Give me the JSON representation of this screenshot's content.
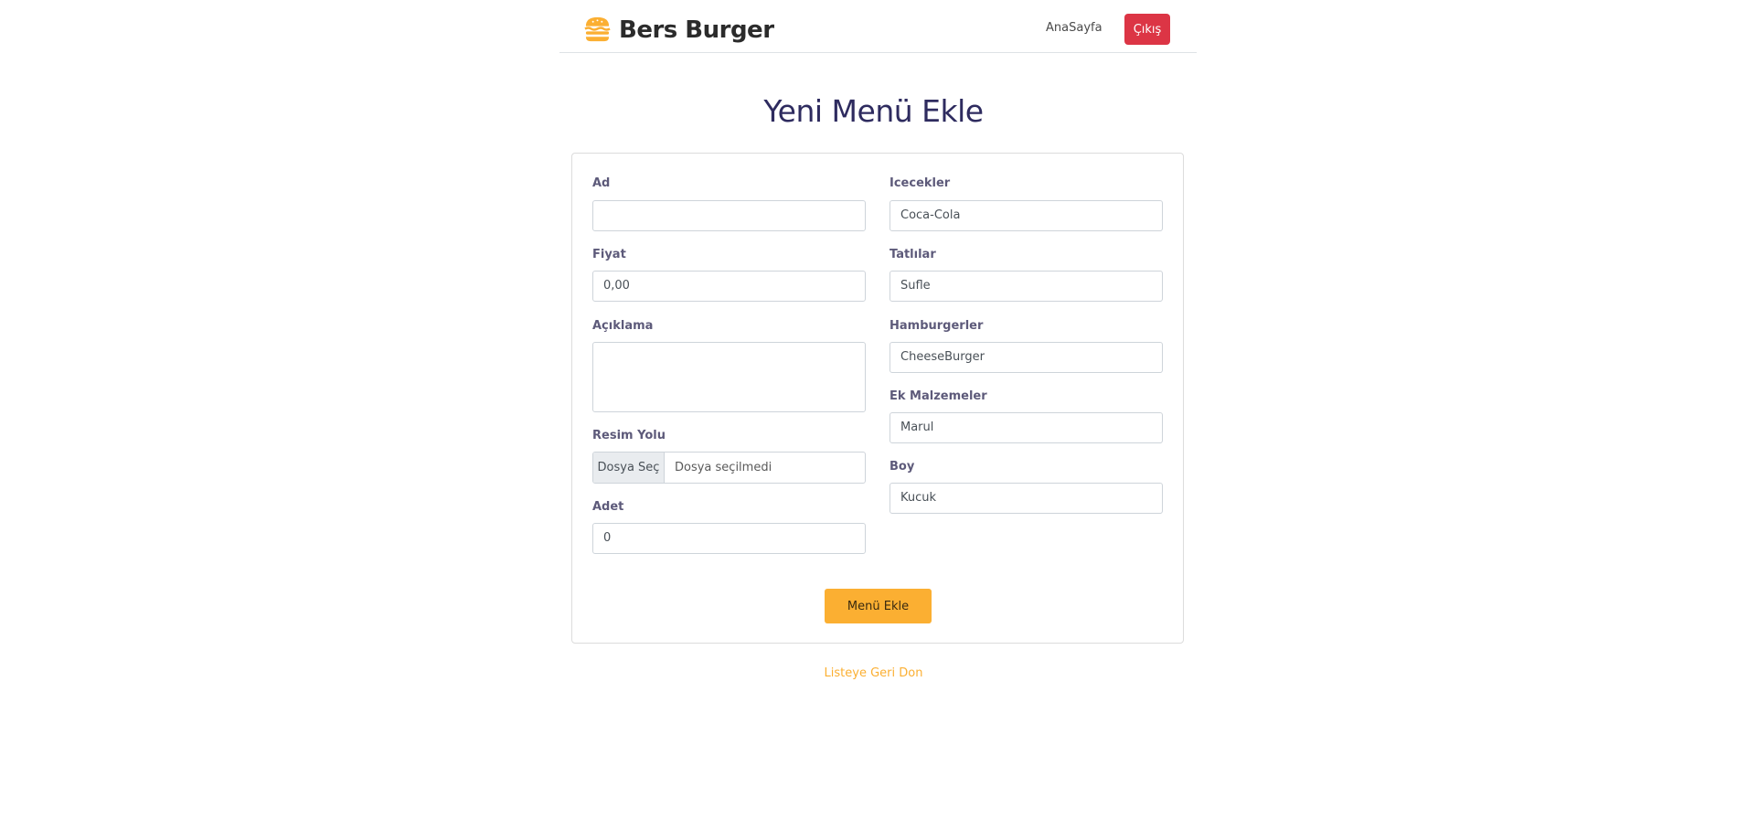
{
  "header": {
    "brand_name": "Bers Burger",
    "brand_icon": "burger-icon",
    "nav_home_label": "AnaSayfa",
    "logout_label": "Çıkış"
  },
  "page": {
    "title": "Yeni Menü Ekle",
    "back_link": "Listeye Geri Don"
  },
  "form": {
    "left": {
      "name": {
        "label": "Ad",
        "value": ""
      },
      "price": {
        "label": "Fiyat",
        "value": "0,00"
      },
      "description": {
        "label": "Açıklama",
        "value": ""
      },
      "image": {
        "label": "Resim Yolu",
        "button_label": "Dosya Seç",
        "file_status": "Dosya seçilmedi"
      },
      "quantity": {
        "label": "Adet",
        "value": "0"
      }
    },
    "right": {
      "drinks": {
        "label": "Icecekler",
        "selected": "Coca-Cola"
      },
      "desserts": {
        "label": "Tatlılar",
        "selected": "Sufle"
      },
      "burgers": {
        "label": "Hamburgerler",
        "selected": "CheeseBurger"
      },
      "extras": {
        "label": "Ek Malzemeler",
        "selected": "Marul"
      },
      "size": {
        "label": "Boy",
        "selected": "Kucuk"
      }
    },
    "submit_label": "Menü Ekle"
  },
  "colors": {
    "accent": "#fbaf32",
    "danger": "#dc3545",
    "title": "#2e2b5f",
    "label": "#5d5a7a"
  }
}
